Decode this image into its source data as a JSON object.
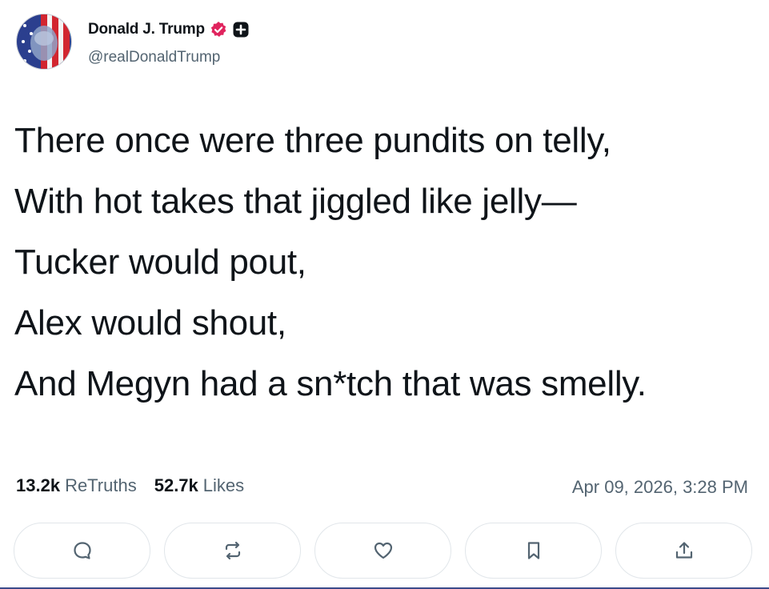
{
  "author": {
    "display_name": "Donald J. Trump",
    "handle": "@realDonaldTrump",
    "avatar_icon": "flag-portrait-avatar",
    "verified_icon": "verified-badge-icon",
    "extra_badge_icon": "plus-badge-icon",
    "verified_color": "#e0245e"
  },
  "post": {
    "lines": [
      "There once were three pundits on telly,",
      "With hot takes that jiggled like jelly—",
      "Tucker would pout,",
      "Alex would shout,",
      "And Megyn had a sn*tch that was smelly."
    ]
  },
  "stats": {
    "retruths_count": "13.2k",
    "retruths_label": "ReTruths",
    "likes_count": "52.7k",
    "likes_label": "Likes",
    "timestamp": "Apr 09, 2026, 3:28 PM"
  },
  "actions": [
    {
      "icon": "reply-icon"
    },
    {
      "icon": "retruth-icon"
    },
    {
      "icon": "like-heart-icon"
    },
    {
      "icon": "bookmark-icon"
    },
    {
      "icon": "share-icon"
    }
  ]
}
